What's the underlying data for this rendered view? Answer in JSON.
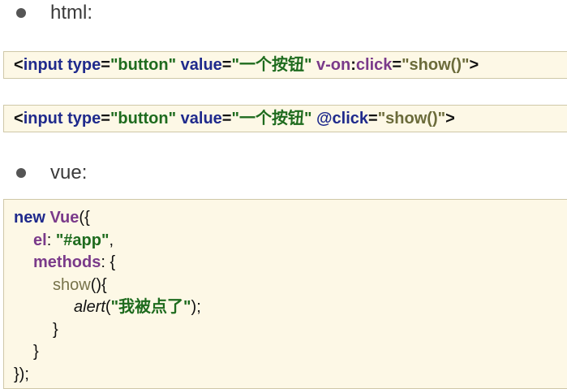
{
  "bullets": {
    "html_label": "html:",
    "vue_label": "vue:"
  },
  "code_html_1": {
    "lt": "<",
    "tag": "input",
    "attr_type": " type",
    "eq1": "=",
    "val_type": "\"button\"",
    "attr_value": " value",
    "eq2": "=",
    "val_value": "\"一个按钮\"",
    "attr_von": " v-on",
    "colon": ":",
    "attr_click": "click",
    "eq3": "=",
    "val_show": "\"show()\"",
    "gt": ">"
  },
  "code_html_2": {
    "lt": "<",
    "tag": "input",
    "attr_type": " type",
    "eq1": "=",
    "val_type": "\"button\"",
    "attr_value": " value",
    "eq2": "=",
    "val_value": "\"一个按钮\"",
    "attr_click": " @click",
    "eq3": "=",
    "val_show": "\"show()\"",
    "gt": ">"
  },
  "code_vue": {
    "l1_new": "new",
    "l1_vue": " Vue",
    "l1_rest": "({",
    "l2_key": "el",
    "l2_colon": ": ",
    "l2_val": "\"#app\"",
    "l2_comma": ",",
    "l3_key": "methods",
    "l3_rest": ": {",
    "l4_fn": "show",
    "l4_rest": "(){",
    "l5_fn": "alert",
    "l5_open": "(",
    "l5_str": "\"我被点了\"",
    "l5_close": ");",
    "l6": "}",
    "l7": "}",
    "l8": "});"
  }
}
